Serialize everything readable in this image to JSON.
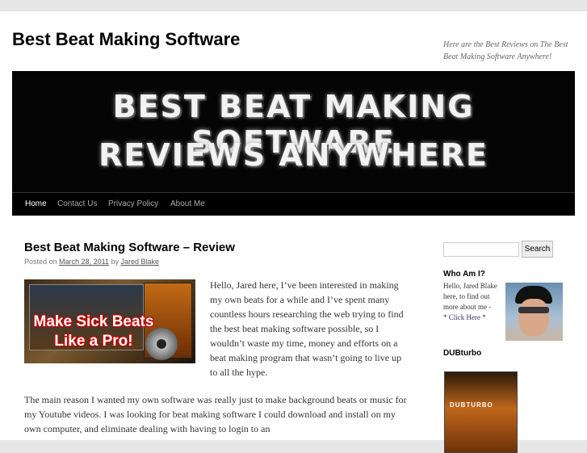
{
  "header": {
    "site_title": "Best Beat Making Software",
    "site_description": "Here are the Best Reviews on The Best Beat Making Software Anywhere!",
    "banner_line1": "BEST BEAT MAKING SOFTWARE",
    "banner_line2": "REVIEWS ANYWHERE"
  },
  "nav": {
    "items": [
      {
        "label": "Home"
      },
      {
        "label": "Contact Us"
      },
      {
        "label": "Privacy Policy"
      },
      {
        "label": "About Me"
      }
    ]
  },
  "post": {
    "title": "Best Beat Making Software – Review",
    "posted_on": "Posted on",
    "date": "March 28, 2011",
    "by": "by",
    "author": "Jared Blake",
    "image_text1": "Make Sick Beats",
    "image_text2": "Like a Pro!",
    "intro": "Hello, Jared here, I’ve been interested in making my own beats for a while and I’ve spent many countless hours researching the web trying to find the best beat making software possible, so I wouldn’t waste my time, money and efforts on a beat making program that wasn’t going to live up to all the hype.",
    "paragraph": "The main reason I wanted my own software was really just to make background beats or music for my Youtube videos. I was looking for beat making software I could download and install on my own computer, and eliminate dealing with having to login to an"
  },
  "sidebar": {
    "search_placeholder": "",
    "search_button": "Search",
    "whoami_title": "Who Am I?",
    "whoami_text": "Hello, Jared Blake here, to find out more about me -",
    "whoami_link": "* Click Here *",
    "dubturbo_title": "DUBturbo",
    "product_logo": "DUBTURBO"
  },
  "colors": {
    "nav_bg": "#000000",
    "link": "#555555"
  }
}
